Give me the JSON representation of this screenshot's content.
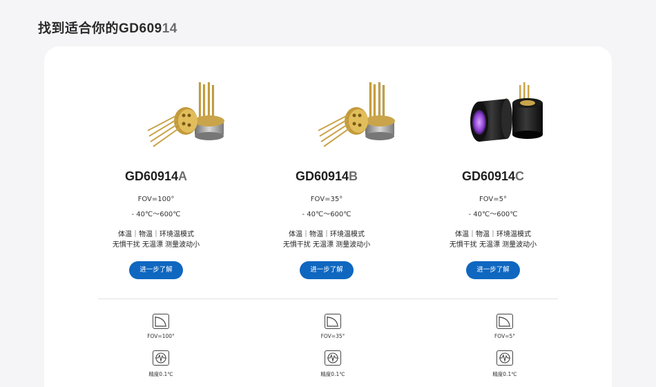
{
  "page": {
    "title_prefix": "找到适合你的",
    "title_model_main": "GD609",
    "title_model_suffix": "14"
  },
  "products": [
    {
      "name_main": "GD60914",
      "name_suffix": "A",
      "fov": "FOV=100°",
      "range": "- 40℃～600℃",
      "modes": "体温｜物温｜环境温模式",
      "features": "无惧干扰 无温漂 测量波动小",
      "button": "进一步了解",
      "image": "gold-pin-sensor"
    },
    {
      "name_main": "GD60914",
      "name_suffix": "B",
      "fov": "FOV=35°",
      "range": "- 40℃～600℃",
      "modes": "体温｜物温｜环境温模式",
      "features": "无惧干扰 无温漂 测量波动小",
      "button": "进一步了解",
      "image": "gold-pin-sensor"
    },
    {
      "name_main": "GD60914",
      "name_suffix": "C",
      "fov": "FOV=5°",
      "range": "- 40℃～600℃",
      "modes": "体温｜物温｜环境温模式",
      "features": "无惧干扰 无温漂 测量波动小",
      "button": "进一步了解",
      "image": "black-lens-sensor"
    }
  ],
  "spec_rows": [
    {
      "icon": "fov-angle-icon",
      "values": [
        "FOV=100°",
        "FOV=35°",
        "FOV=5°"
      ]
    },
    {
      "icon": "precision-wave-icon",
      "values": [
        "精度0.1℃",
        "精度0.1℃",
        "精度0.1℃"
      ]
    }
  ],
  "colors": {
    "button": "#0f67c0",
    "background": "#f5f5f7",
    "card": "#ffffff"
  }
}
